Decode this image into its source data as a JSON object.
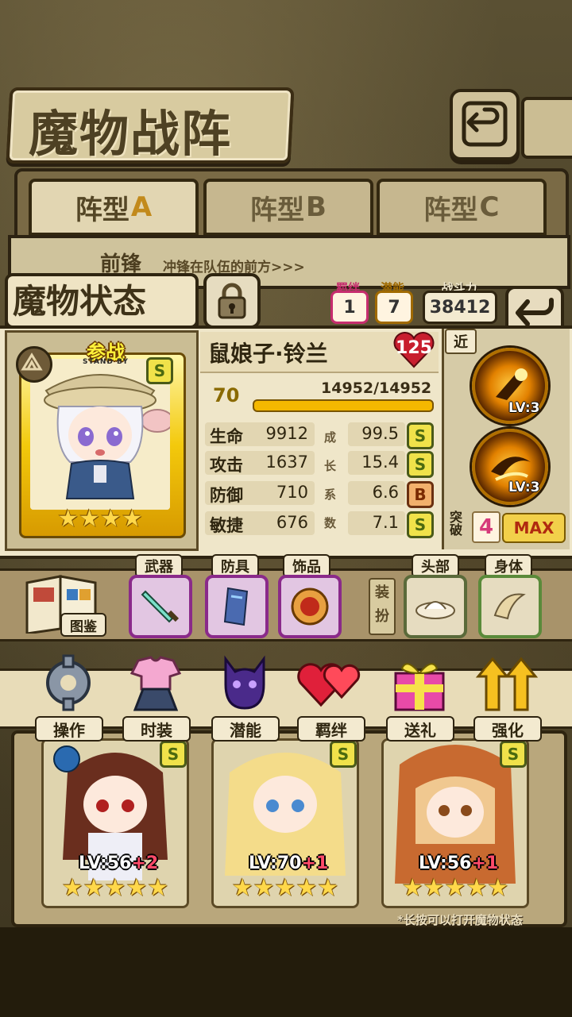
{
  "header": {
    "title": "魔物战阵"
  },
  "formation_tabs": [
    {
      "prefix": "阵型",
      "letter": "A",
      "active": true
    },
    {
      "prefix": "阵型",
      "letter": "B",
      "active": false
    },
    {
      "prefix": "阵型",
      "letter": "C",
      "active": false
    }
  ],
  "vanguard": {
    "title": "前锋",
    "desc": "冲锋在队伍的前方>>>"
  },
  "status": {
    "title": "魔物状态",
    "bond_label": "羁绊",
    "bond_value": "1",
    "potential_label": "潜能",
    "potential_value": "7",
    "power_label": "战斗力",
    "power_value": "38412"
  },
  "character": {
    "standby": "参战",
    "standby_sub": "STAND BY",
    "rank": "S",
    "stars": 4,
    "name": "鼠娘子·铃兰",
    "heart_value": "125",
    "level": "70",
    "hp": "14952/14952",
    "hp_fraction": 1.0,
    "stats": [
      {
        "name": "生命",
        "value": "9912",
        "growth": "99.5",
        "rank": "S"
      },
      {
        "name": "攻击",
        "value": "1637",
        "growth": "15.4",
        "rank": "S"
      },
      {
        "name": "防御",
        "value": "710",
        "growth": "6.6",
        "rank": "B"
      },
      {
        "name": "敏捷",
        "value": "676",
        "growth": "7.1",
        "rank": "S"
      }
    ],
    "growth_label": [
      "成",
      "长",
      "系",
      "数"
    ]
  },
  "skills": {
    "range": "近",
    "list": [
      {
        "lv": "LV:3"
      },
      {
        "lv": "LV:3"
      }
    ],
    "break_label": "突破",
    "break_value": "4",
    "max_label": "MAX"
  },
  "equipment": {
    "codex_label": "图鉴",
    "weapon_label": "武器",
    "armor_label": "防具",
    "accessory_label": "饰品",
    "dress_label": "装扮",
    "head_label": "头部",
    "body_label": "身体"
  },
  "actions": [
    {
      "label": "操作",
      "icon": "gear-icon"
    },
    {
      "label": "时装",
      "icon": "outfit-icon"
    },
    {
      "label": "潜能",
      "icon": "demon-icon"
    },
    {
      "label": "羁绊",
      "icon": "hearts-icon"
    },
    {
      "label": "送礼",
      "icon": "gift-icon"
    },
    {
      "label": "强化",
      "icon": "up-arrows-icon"
    }
  ],
  "team": [
    {
      "lv": "LV:56",
      "plus": "+2",
      "stars": 5
    },
    {
      "lv": "LV:70",
      "plus": "+1",
      "stars": 5
    },
    {
      "lv": "LV:56",
      "plus": "+1",
      "stars": 5
    }
  ],
  "hint": "*长按可以打开魔物状态"
}
